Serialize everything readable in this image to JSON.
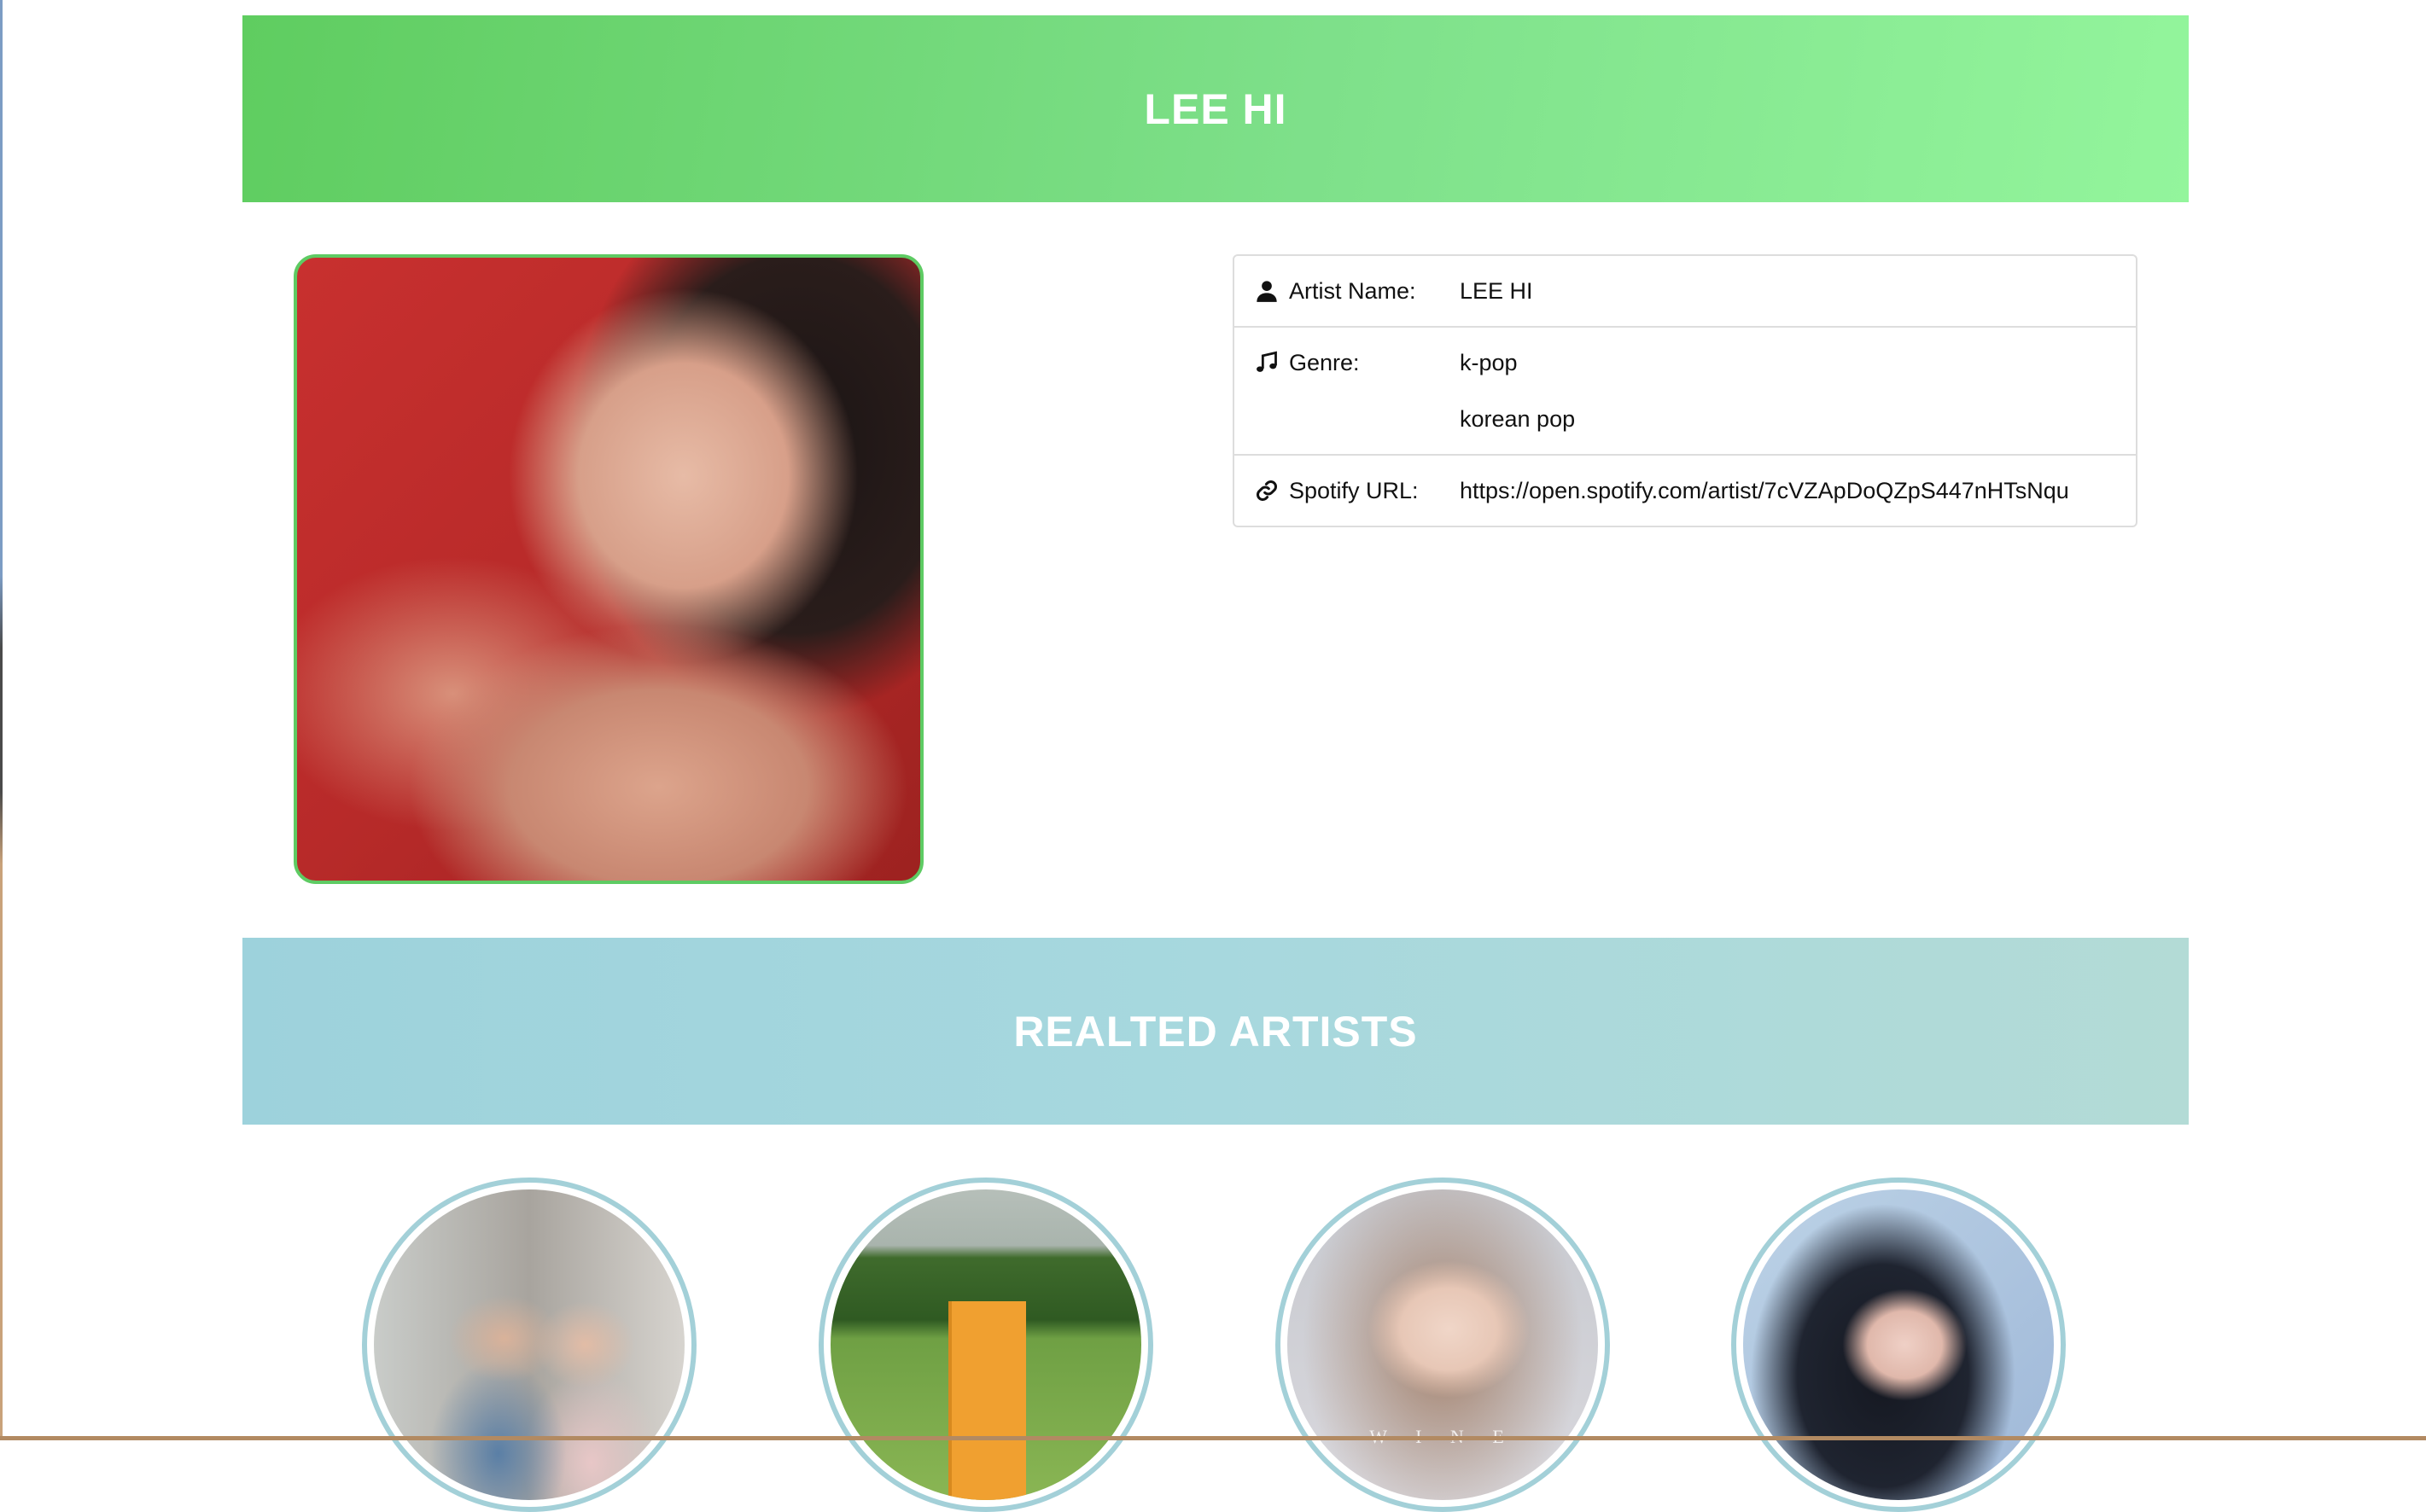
{
  "header": {
    "title": "LEE HI"
  },
  "artist": {
    "photo_icon": "artist-portrait",
    "info": {
      "name_label": "Artist Name:",
      "name_value": "LEE HI",
      "genre_label": "Genre:",
      "genres": [
        "k-pop",
        "korean pop"
      ],
      "url_label": "Spotify URL:",
      "url_value": "https://open.spotify.com/artist/7cVZApDoQZpS447nHTsNqu"
    },
    "icons": {
      "name": "user-icon",
      "genre": "music-note-icon",
      "url": "link-icon"
    }
  },
  "related": {
    "title": "REALTED ARTISTS",
    "items": [
      {
        "image": "related-artist-1-photo"
      },
      {
        "image": "related-artist-2-photo"
      },
      {
        "image": "related-artist-3-photo",
        "watermark": "W I N E"
      },
      {
        "image": "related-artist-4-photo"
      }
    ]
  },
  "colors": {
    "header_start": "#5fcd60",
    "header_end": "#93f59c",
    "related_start": "#9dd2dc",
    "related_end": "#b3dbd6",
    "photo_border": "#5ecb63",
    "circle_border": "#a3d0d8"
  }
}
